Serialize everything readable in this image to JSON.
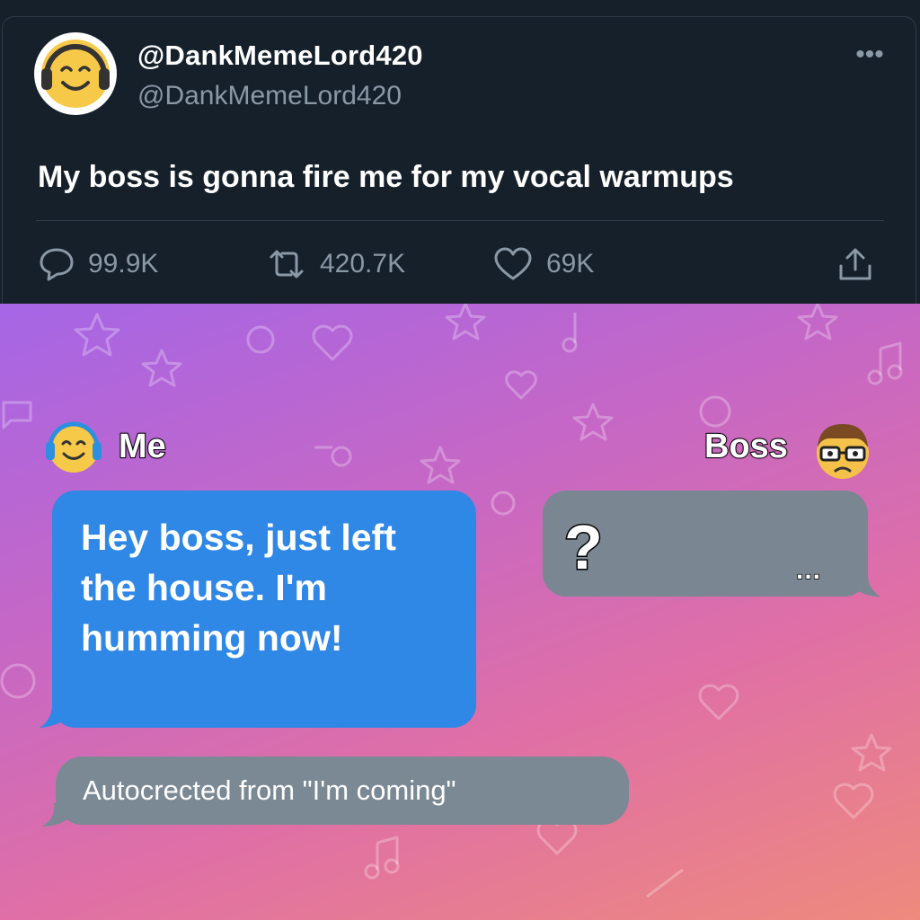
{
  "tweet": {
    "display_name": "@DankMemeLord420",
    "handle": "@DankMemeLord420",
    "more_icon": "more-horizontal-icon",
    "text": "My boss is gonna fire me for my vocal warmups",
    "actions": {
      "replies": "99.9K",
      "retweets": "420.7K",
      "likes": "69K"
    },
    "icons": [
      "reply-icon",
      "retweet-icon",
      "heart-icon",
      "share-icon"
    ]
  },
  "meme": {
    "me_label": "Me",
    "boss_label": "Boss",
    "me_message": "Hey boss, just left the house. I'm humming now!",
    "boss_reply": "?",
    "boss_typing": "...",
    "autocorrect_note": "Autocrected from \"I'm coming\"",
    "colors": {
      "me_bubble": "#2f87e6",
      "boss_bubble": "#7a8792",
      "gradient_start": "#a566e6",
      "gradient_end": "#ee8a7d"
    }
  }
}
